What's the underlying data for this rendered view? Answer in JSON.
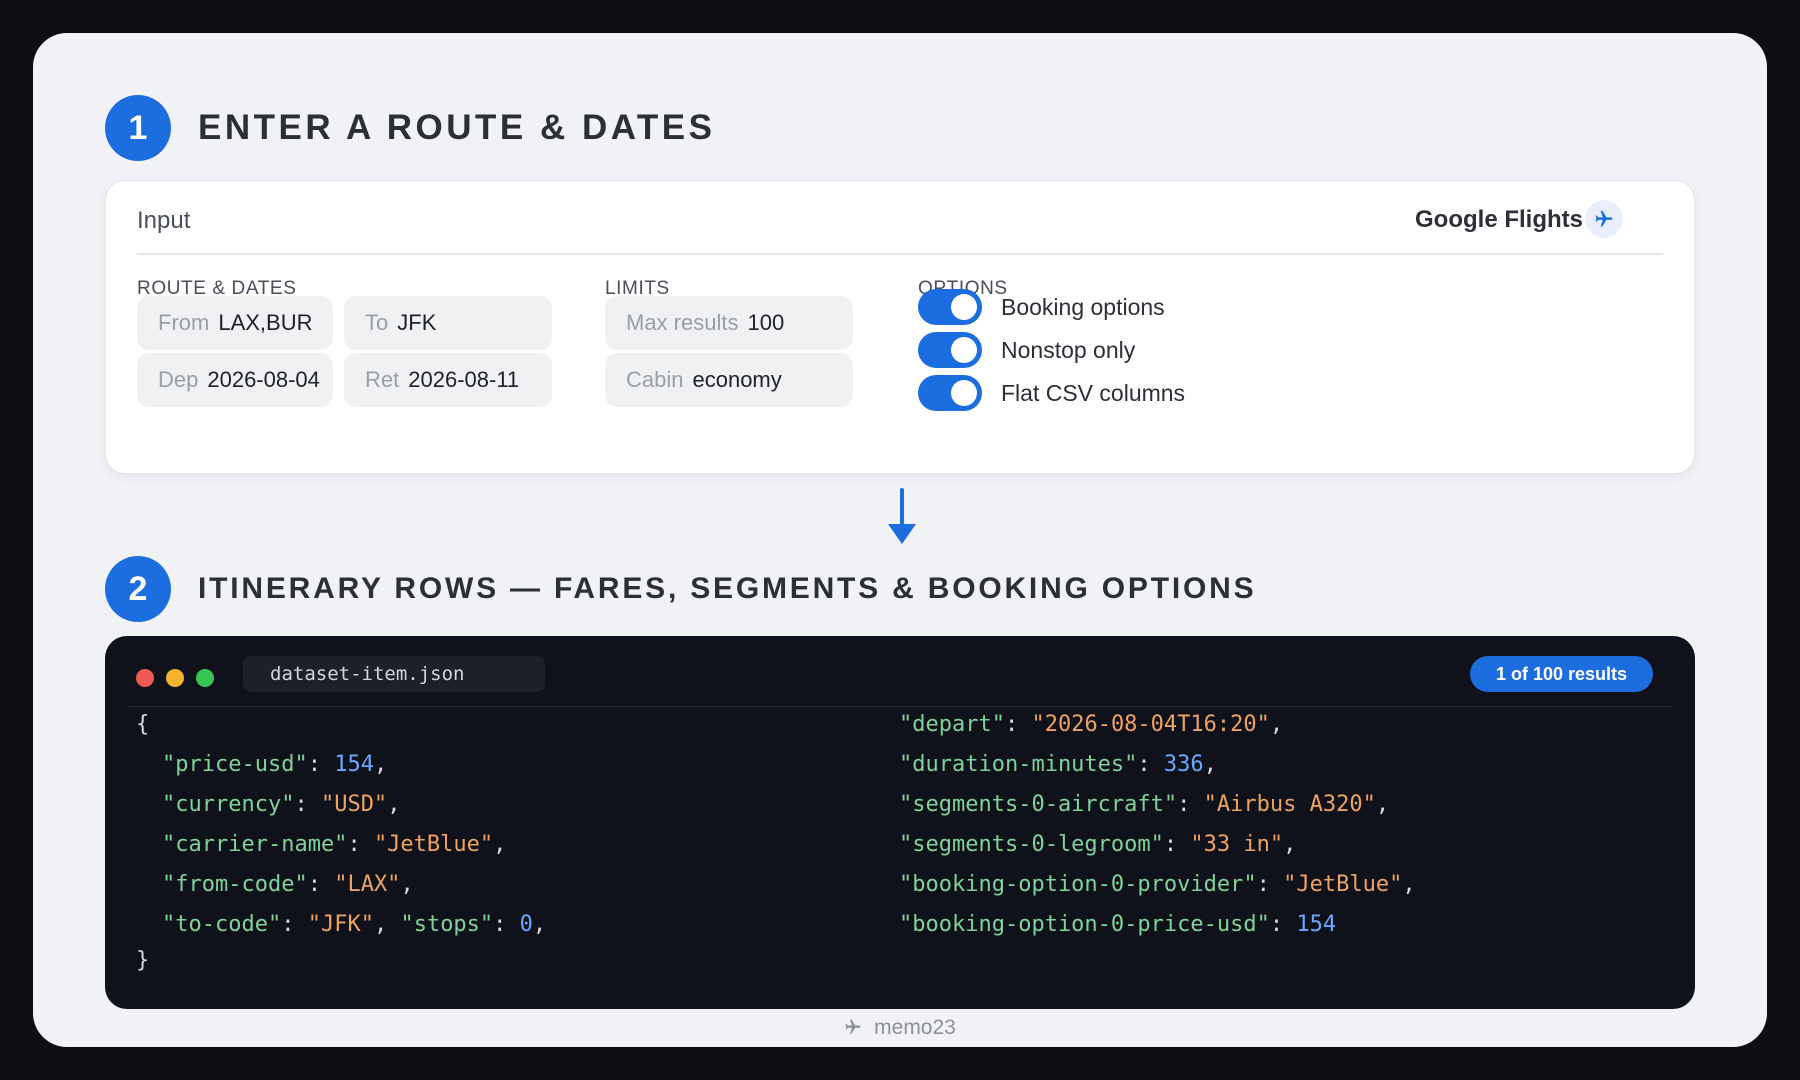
{
  "step1": {
    "number": "1",
    "title": "ENTER A ROUTE & DATES"
  },
  "input_card": {
    "title": "Input",
    "brand": "Google Flights",
    "brand_icon": "airplane-icon",
    "route": {
      "label": "ROUTE & DATES",
      "from_label": "From",
      "from_value": "LAX,BUR",
      "to_label": "To",
      "to_value": "JFK",
      "dep_label": "Dep",
      "dep_value": "2026-08-04",
      "ret_label": "Ret",
      "ret_value": "2026-08-11"
    },
    "limits": {
      "label": "LIMITS",
      "max_label": "Max results",
      "max_value": "100",
      "cabin_label": "Cabin",
      "cabin_value": "economy"
    },
    "options": {
      "label": "OPTIONS",
      "items": [
        {
          "label": "Booking options",
          "on": true
        },
        {
          "label": "Nonstop only",
          "on": true
        },
        {
          "label": "Flat CSV columns",
          "on": true
        }
      ]
    },
    "accent_color": "#1b6de0"
  },
  "step2": {
    "number": "2",
    "title": "ITINERARY ROWS — FARES, SEGMENTS & BOOKING OPTIONS"
  },
  "code_card": {
    "filename": "dataset-item.json",
    "results_badge": "1 of 100 results",
    "window_dots": [
      "#ee5a55",
      "#f4b32b",
      "#37c653"
    ],
    "open_brace": "{",
    "close_brace": "}",
    "left": [
      {
        "key": "\"price-usd\"",
        "value": "154",
        "type": "number"
      },
      {
        "key": "\"currency\"",
        "value": "\"USD\"",
        "type": "string"
      },
      {
        "key": "\"carrier-name\"",
        "value": "\"JetBlue\"",
        "type": "string"
      },
      {
        "key": "\"from-code\"",
        "value": "\"LAX\"",
        "type": "string"
      },
      {
        "key": "\"to-code\"",
        "value": "\"JFK\"",
        "type": "string",
        "key2": "\"stops\"",
        "value2": "0",
        "type2": "number"
      }
    ],
    "right": [
      {
        "key": "\"depart\"",
        "value": "\"2026-08-04T16:20\"",
        "type": "string"
      },
      {
        "key": "\"duration-minutes\"",
        "value": "336",
        "type": "number"
      },
      {
        "key": "\"segments-0-aircraft\"",
        "value": "\"Airbus A320\"",
        "type": "string"
      },
      {
        "key": "\"segments-0-legroom\"",
        "value": "\"33 in\"",
        "type": "string"
      },
      {
        "key": "\"booking-option-0-provider\"",
        "value": "\"JetBlue\"",
        "type": "string"
      },
      {
        "key": "\"booking-option-0-price-usd\"",
        "value": "154",
        "type": "number",
        "last": true
      }
    ]
  },
  "footer": {
    "text": "memo23",
    "icon": "airplane-icon"
  }
}
